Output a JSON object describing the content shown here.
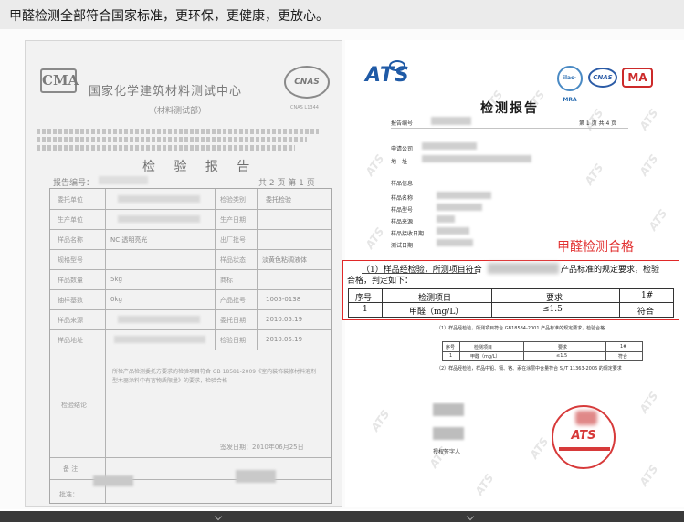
{
  "banner": {
    "text": "甲醛检测全部符合国家标准，更环保，更健康，更放心。"
  },
  "left_cert": {
    "logo_cma": "CMA",
    "lab_name": "国家化学建筑材料测试中心",
    "lab_sub": "（材料测试部）",
    "logo_cnas": "CNAS",
    "cnas_no": "CNAS L1344",
    "title": "检 验 报 告",
    "report_no_label": "报告编号：",
    "page_info": "共 2 页 第 1 页",
    "rows": [
      {
        "label": "委托单位",
        "value": "",
        "label2": "检验类别",
        "value2": "委托检验"
      },
      {
        "label": "生产单位",
        "value": "",
        "label2": "生产日期",
        "value2": ""
      },
      {
        "label": "样品名称",
        "value": "NC 透明亮光",
        "label2": "出厂批号",
        "value2": ""
      },
      {
        "label": "规格型号",
        "value": "",
        "label2": "样品状态",
        "value2": "淡黄色粘稠液体"
      },
      {
        "label": "样品数量",
        "value": "5kg",
        "label2": "商标",
        "value2": ""
      },
      {
        "label": "抽样基数",
        "value": "0kg",
        "label2": "产品批号",
        "value2": "1005-0138"
      },
      {
        "label": "样品来源",
        "value": "",
        "label2": "委托日期",
        "value2": "2010.05.19"
      },
      {
        "label": "样品地址",
        "value": "",
        "label2": "检验日期",
        "value2": "2010.05.19"
      }
    ],
    "conclusion_label": "检验结论",
    "conclusion_text": "所检产品检测委托方要求的检验项目符合 GB 18581-2009《室内装饰装修材料溶剂型木器涂料中有害物质限量》的要求，检验合格",
    "issue_date": "签发日期：2010年06月25日",
    "remark_label": "备 注",
    "approver_label": "批准："
  },
  "right_cert": {
    "logo_ats": "ATS",
    "logo_ilac": "ilac-MRA",
    "logo_cnas": "CNAS",
    "logo_ma": "MA",
    "title": "检测报告",
    "report_no_label": "报告编号",
    "page_info": "第 1 页 共 4 页",
    "applicant_label": "申请公司",
    "address_label": "地　址",
    "sample_info_label": "样品信息",
    "sample_name_label": "样品名称",
    "sample_model_label": "样品型号",
    "sample_source_label": "样品来源",
    "receive_date_label": "样品接收日期",
    "test_date_label": "测试日期",
    "highlight_label": "甲醛检测合格",
    "result_intro_part1": "（1）样品经检验，所测项目符合",
    "result_intro_part2": "产品标准的规定要求，检验",
    "result_intro_line2": "合格，判定如下：",
    "table_headers": [
      "序号",
      "检测项目",
      "要求",
      "1#"
    ],
    "table_row": [
      "1",
      "甲醛（mg/L）",
      "≤1.5",
      "符合"
    ],
    "small_note": "（1）样品经检验，所测项目符合 GB18584-2001 产品标准的规定要求，检验合格",
    "small_table_headers": [
      "序号",
      "检测项目",
      "要求",
      "1#"
    ],
    "small_table_row": [
      "1",
      "甲醛（mg/L）",
      "≤1.5",
      "符合"
    ],
    "note2": "（2）样品经检验，样品中铅、镉、铬、汞在涂层中含量符合 SJ/T 11363-2006 的规定要求",
    "stamp_text": "ATS",
    "signer_label": "授权签字人",
    "watermark": "ATS"
  }
}
